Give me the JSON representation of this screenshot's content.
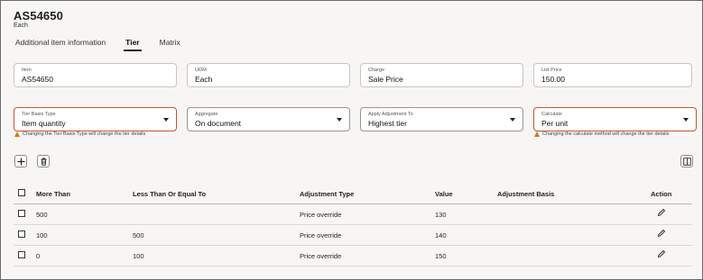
{
  "header": {
    "title": "AS54650",
    "subtitle": "Each"
  },
  "tabs": [
    {
      "label": "Additional item information"
    },
    {
      "label": "Tier"
    },
    {
      "label": "Matrix"
    }
  ],
  "active_tab": "Tier",
  "info_fields": {
    "item": {
      "label": "Item",
      "value": "AS54650"
    },
    "uom": {
      "label": "UOM",
      "value": "Each"
    },
    "charge": {
      "label": "Charge",
      "value": "Sale Price"
    },
    "list_price": {
      "label": "List Price",
      "value": "150.00"
    }
  },
  "select_fields": {
    "tier_basis_type": {
      "label": "Tier Basis Type",
      "value": "Item quantity"
    },
    "aggregate": {
      "label": "Aggregate",
      "value": "On document"
    },
    "apply_adjustment_to": {
      "label": "Apply Adjustment To",
      "value": "Highest tier"
    },
    "calculate": {
      "label": "Calculate",
      "value": "Per unit"
    }
  },
  "warnings": {
    "tier_basis": "Changing the Tier Basis Type will change the tier details",
    "calculate": "Changing the calculate method will change the tier details"
  },
  "toolbar": {
    "add_icon": "plus-icon",
    "delete_icon": "trash-icon",
    "columns_icon": "column-panel-icon"
  },
  "table": {
    "columns": {
      "more_than": "More Than",
      "less_than": "Less Than Or Equal To",
      "adjustment_type": "Adjustment Type",
      "value": "Value",
      "adjustment_basis": "Adjustment Basis",
      "action": "Action"
    },
    "rows": [
      {
        "more_than": "500",
        "less_than": "",
        "adjustment_type": "Price override",
        "value": "130",
        "adjustment_basis": ""
      },
      {
        "more_than": "100",
        "less_than": "500",
        "adjustment_type": "Price override",
        "value": "140",
        "adjustment_basis": ""
      },
      {
        "more_than": "0",
        "less_than": "100",
        "adjustment_type": "Price override",
        "value": "150",
        "adjustment_basis": ""
      }
    ]
  },
  "colors": {
    "accent_border": "#c7542f",
    "warning": "#d07a1a",
    "background": "#f7f6f4"
  }
}
